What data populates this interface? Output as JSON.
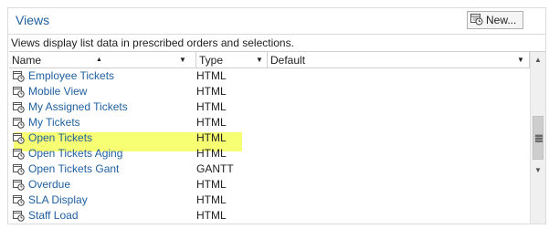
{
  "panel": {
    "title": "Views",
    "new_button": "New...",
    "description": "Views display list data in prescribed orders and selections."
  },
  "grid": {
    "columns": [
      "Name",
      "Type",
      "Default"
    ],
    "rows": [
      {
        "name": "Employee Tickets",
        "type": "HTML"
      },
      {
        "name": "Mobile View",
        "type": "HTML"
      },
      {
        "name": "My Assigned Tickets",
        "type": "HTML"
      },
      {
        "name": "My Tickets",
        "type": "HTML"
      },
      {
        "name": "Open Tickets",
        "type": "HTML"
      },
      {
        "name": "Open Tickets Aging",
        "type": "HTML"
      },
      {
        "name": "Open Tickets Gant",
        "type": "GANTT"
      },
      {
        "name": "Overdue",
        "type": "HTML"
      },
      {
        "name": "SLA Display",
        "type": "HTML"
      },
      {
        "name": "Staff Load",
        "type": "HTML"
      }
    ],
    "highlighted_row": "Open Tickets"
  },
  "colors": {
    "link": "#1f5f9f",
    "highlight": "#f6ff5a"
  },
  "icons": [
    "view-icon",
    "sort-ascending-icon",
    "dropdown-arrow-icon",
    "scroll-up-icon",
    "scroll-down-icon",
    "scroll-grip-icon"
  ]
}
